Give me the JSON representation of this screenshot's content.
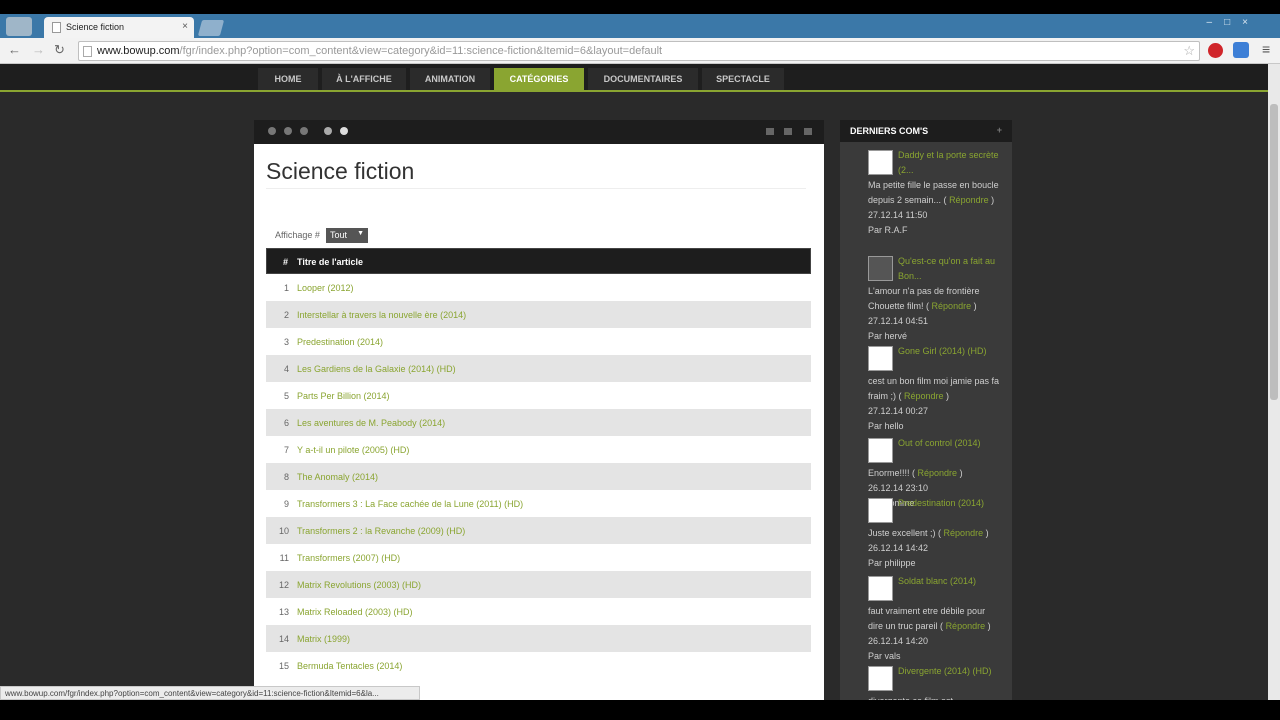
{
  "browser": {
    "tab_title": "Science fiction",
    "tab_close": "×",
    "window_controls": "–□×",
    "url_domain": "www.bowup.com",
    "url_rest": "/fgr/index.php?option=com_content&view=category&id=11:science-fiction&Itemid=6&layout=default",
    "nav": {
      "back": "←",
      "forward": "→",
      "reload": "↻",
      "star": "☆",
      "menu": "≡"
    },
    "status_url": "www.bowup.com/fgr/index.php?option=com_content&view=category&id=11:science-fiction&Itemid=6&la..."
  },
  "sitenav": {
    "items": [
      "HOME",
      "À L'AFFICHE",
      "ANIMATION",
      "CATÉGORIES",
      "DOCUMENTAIRES",
      "SPECTACLE"
    ],
    "active_index": 3,
    "active_color": "#8aa531"
  },
  "main": {
    "title": "Science fiction",
    "display_label": "Affichage #",
    "display_value": "Tout",
    "table_header": {
      "num": "#",
      "title": "Titre de l'article"
    },
    "rows": [
      {
        "num": "1",
        "title": "Looper (2012)"
      },
      {
        "num": "2",
        "title": "Interstellar à travers la nouvelle ère (2014)"
      },
      {
        "num": "3",
        "title": "Predestination (2014)"
      },
      {
        "num": "4",
        "title": "Les Gardiens de la Galaxie (2014) (HD)"
      },
      {
        "num": "5",
        "title": "Parts Per Billion (2014)"
      },
      {
        "num": "6",
        "title": "Les aventures de M. Peabody (2014)"
      },
      {
        "num": "7",
        "title": "Y a-t-il un pilote (2005) (HD)"
      },
      {
        "num": "8",
        "title": "The Anomaly (2014)"
      },
      {
        "num": "9",
        "title": "Transformers 3 : La Face cachée de la Lune (2011) (HD)"
      },
      {
        "num": "10",
        "title": "Transformers 2 : la Revanche (2009) (HD)"
      },
      {
        "num": "11",
        "title": "Transformers (2007) (HD)"
      },
      {
        "num": "12",
        "title": "Matrix Revolutions (2003) (HD)"
      },
      {
        "num": "13",
        "title": "Matrix Reloaded (2003) (HD)"
      },
      {
        "num": "14",
        "title": "Matrix (1999)"
      },
      {
        "num": "15",
        "title": "Bermuda Tentacles (2014)"
      }
    ]
  },
  "sidebar": {
    "title": "DERNIERS COM'S",
    "toggle": "+",
    "comments": [
      {
        "link": "Daddy et la porte secrète (2...",
        "text": "Ma petite fille le passe en boucle depuis 2 semain... (",
        "reply": "Répondre",
        "date": "27.12.14 11:50",
        "author": "Par R.A.F"
      },
      {
        "link": "Qu'est-ce qu'on a fait au Bon...",
        "text": "L'amour n'a pas de frontière Chouette film! (",
        "reply": "Répondre",
        "date": "27.12.14 04:51",
        "author": "Par hervé"
      },
      {
        "link": "Gone Girl (2014) (HD)",
        "text": "cest un bon film moi jamie pas fa fraim ;) (",
        "reply": "Répondre",
        "date": "27.12.14 00:27",
        "author": "Par hello"
      },
      {
        "link": "Out of control (2014)",
        "text": "Enorme!!!! (",
        "reply": "Répondre",
        "date": "26.12.14 23:10",
        "author": "Par homme"
      },
      {
        "link": "Predestination (2014)",
        "text": "Juste excellent ;) (",
        "reply": "Répondre",
        "date": "26.12.14 14:42",
        "author": "Par philippe"
      },
      {
        "link": "Soldat blanc (2014)",
        "text": "faut vraiment etre débile pour dire un truc pareil (",
        "reply": "Répondre",
        "date": "26.12.14 14:20",
        "author": "Par vals"
      },
      {
        "link": "Divergente (2014) (HD)",
        "text": "divergente ce film est",
        "reply": "",
        "date": "",
        "author": ""
      }
    ]
  }
}
